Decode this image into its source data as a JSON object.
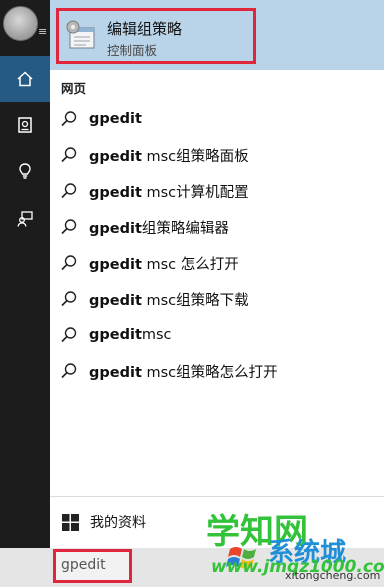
{
  "best_match": {
    "title": "编辑组策略",
    "subtitle": "控制面板"
  },
  "section_label": "网页",
  "suggestions": [
    {
      "keyword": "gpedit",
      "rest": ""
    },
    {
      "keyword": "gpedit",
      "rest": " msc组策略面板"
    },
    {
      "keyword": "gpedit",
      "rest": " msc计算机配置"
    },
    {
      "keyword": "gpedit",
      "rest": "组策略编辑器"
    },
    {
      "keyword": "gpedit",
      "rest": " msc 怎么打开"
    },
    {
      "keyword": "gpedit",
      "rest": " msc组策略下载"
    },
    {
      "keyword": "gpedit",
      "rest": "msc"
    },
    {
      "keyword": "gpedit",
      "rest": " msc组策略怎么打开"
    }
  ],
  "my_stuff_label": "我的资料",
  "search": {
    "query": "gpedit"
  },
  "watermark": {
    "brand": "学知网",
    "sub": "系统城",
    "url_a": "www.jmqz1000.com",
    "url_b": "xitongcheng.com"
  },
  "colors": {
    "rail": "#1c1c1c",
    "active": "#255a84",
    "best_bg": "#b9d4e8",
    "highlight": "#e0263d"
  },
  "icons": [
    "home-icon",
    "notebook-icon",
    "lightbulb-icon",
    "feedback-icon",
    "search-icon",
    "windows-icon"
  ]
}
